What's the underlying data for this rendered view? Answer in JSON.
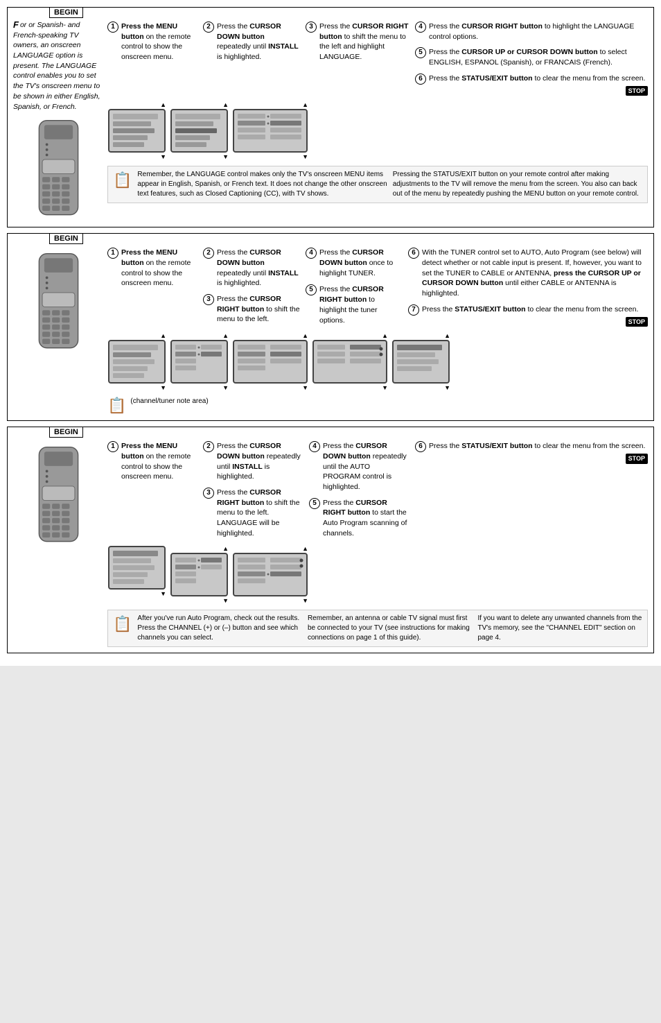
{
  "sections": [
    {
      "id": "section1",
      "begin": "BEGIN",
      "hasIntro": true,
      "intro": "or or Spanish- and French-speaking TV owners, an onscreen LANGUAGE option is present. The LANGUAGE control enables you to set the TV's onscreen menu to be shown in either English, Spanish, or French.",
      "steps": [
        {
          "num": "1",
          "text": "Press the MENU button on the remote control to show the onscreen menu."
        },
        {
          "num": "2",
          "text": "Press the CURSOR DOWN button repeatedly until INSTALL is highlighted."
        },
        {
          "num": "3",
          "text": "Press the CURSOR RIGHT button to shift the menu to the left and highlight LANGUAGE."
        },
        {
          "num": "4",
          "text": "Press the CURSOR RIGHT button to highlight the LANGUAGE control options."
        },
        {
          "num": "5",
          "text": "Press the CURSOR UP or CURSOR DOWN button to select ENGLISH, ESPANOL (Spanish), or FRANCAIS (French)."
        },
        {
          "num": "6",
          "text": "Press the STATUS/EXIT button to clear the menu from the screen."
        }
      ],
      "stop": "STOP",
      "note": {
        "icon": "📝",
        "leftText": "Remember, the LANGUAGE control makes only the TV's onscreen MENU items appear in English, Spanish, or French text. It does not change the other onscreen text features, such as Closed Captioning (CC), with TV shows.",
        "rightText": "Pressing the STATUS/EXIT button on your remote control after making adjustments to the TV will remove the menu from the screen. You also can back out of the menu by repeatedly pushing the MENU button on your remote control."
      }
    },
    {
      "id": "section2",
      "begin": "BEGIN",
      "hasIntro": false,
      "steps": [
        {
          "num": "1",
          "text": "Press the MENU button on the remote control to show the onscreen menu."
        },
        {
          "num": "2",
          "text": "Press the CURSOR DOWN button repeatedly until INSTALL is highlighted."
        },
        {
          "num": "3",
          "text": "Press the CURSOR RIGHT button to shift the menu to the left."
        },
        {
          "num": "4",
          "text": "Press the CURSOR DOWN button once to highlight TUNER."
        },
        {
          "num": "5",
          "text": "Press the CURSOR RIGHT button to highlight the tuner options."
        },
        {
          "num": "6",
          "text": "With the TUNER control set to AUTO, Auto Program (see below) will detect whether or not cable input is present. If, however, you want to set the TUNER to CABLE or ANTENNA, press the CURSOR UP or CURSOR DOWN button until either CABLE or ANTENNA is highlighted."
        },
        {
          "num": "7",
          "text": "Press the STATUS/EXIT button to clear the menu from the screen."
        }
      ],
      "stop": "STOP"
    },
    {
      "id": "section3",
      "begin": "BEGIN",
      "hasIntro": false,
      "steps": [
        {
          "num": "1",
          "text": "Press the MENU button on the remote control to show the onscreen menu."
        },
        {
          "num": "2",
          "text": "Press the CURSOR DOWN button repeatedly until INSTALL is highlighted."
        },
        {
          "num": "3",
          "text": "Press the CURSOR RIGHT button to shift the menu to the left. LANGUAGE will be highlighted."
        },
        {
          "num": "4",
          "text": "Press the CURSOR DOWN button repeatedly until the AUTO PROGRAM control is highlighted."
        },
        {
          "num": "5",
          "text": "Press the CURSOR RIGHT button to start the Auto Program scanning of channels."
        },
        {
          "num": "6",
          "text": "Press the STATUS/EXIT button to clear the menu from the screen."
        }
      ],
      "stop": "STOP",
      "bottomNotes": [
        {
          "icon": "📝",
          "text": "After you've run Auto Program, check out the results. Press the CHANNEL (+) or (–) button and see which channels you can select."
        },
        {
          "text": "Remember, an antenna or cable TV signal must first be connected to your TV (see instructions for making connections on page 1 of this guide)."
        },
        {
          "text": "If you want to delete any unwanted channels from the TV's memory, see the \"CHANNEL EDIT\" section on page 4."
        }
      ]
    }
  ]
}
